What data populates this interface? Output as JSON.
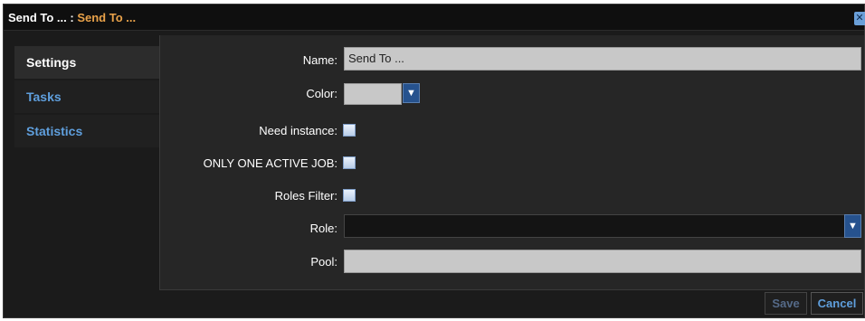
{
  "dialog": {
    "title_main": "Send To ...",
    "title_separator": " : ",
    "title_sub": "Send To ...",
    "close_icon": "close-icon"
  },
  "sidebar": {
    "items": [
      {
        "label": "Settings",
        "active": true
      },
      {
        "label": "Tasks",
        "active": false
      },
      {
        "label": "Statistics",
        "active": false
      }
    ]
  },
  "form": {
    "name_label": "Name:",
    "name_value": "Send To ...",
    "color_label": "Color:",
    "need_instance_label": "Need instance:",
    "only_one_active_job_label": "ONLY ONE ACTIVE JOB:",
    "roles_filter_label": "Roles Filter:",
    "role_label": "Role:",
    "role_value": "",
    "pool_label": "Pool:",
    "pool_value": ""
  },
  "footer": {
    "save_label": "Save",
    "cancel_label": "Cancel"
  },
  "colors": {
    "accent_blue": "#5f9fdd",
    "title_orange": "#e9a24a",
    "background": "#1b1b1b"
  }
}
